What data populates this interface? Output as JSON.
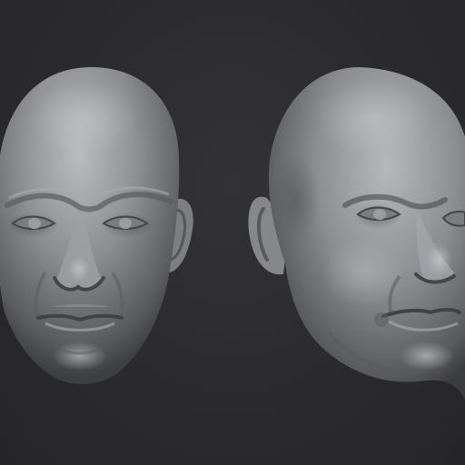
{
  "scene": {
    "background_color": "#2b2b2d",
    "clay_base_color": "#8d8f93",
    "clay_highlight_color": "#b4b6ba",
    "clay_shadow_color": "#4b4c50",
    "models": [
      {
        "view": "front"
      },
      {
        "view": "three-quarter"
      }
    ]
  }
}
